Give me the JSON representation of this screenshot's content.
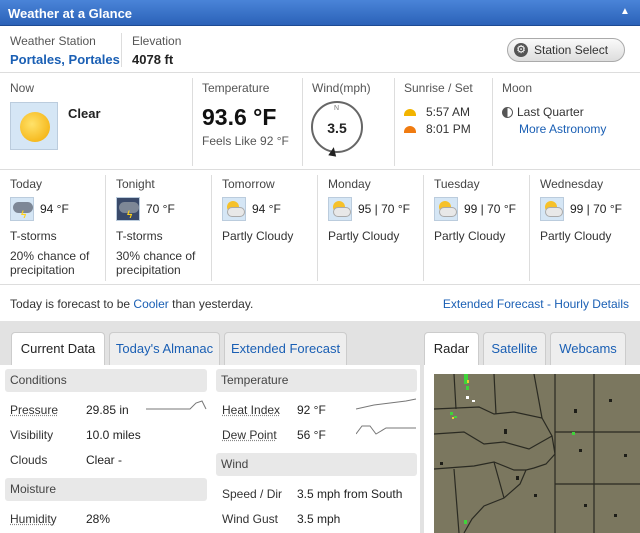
{
  "title": "Weather at a Glance",
  "station": {
    "label": "Weather Station",
    "name": "Portales, Portales"
  },
  "elevation": {
    "label": "Elevation",
    "value": "4078 ft"
  },
  "station_select": "Station Select",
  "now": {
    "label": "Now",
    "condition": "Clear",
    "icon": "sun-icon"
  },
  "temperature": {
    "label": "Temperature",
    "value": "93.6 °F",
    "feels_like": "Feels Like 92 °F"
  },
  "wind": {
    "label": "Wind(mph)",
    "speed": "3.5",
    "compass_n": "N"
  },
  "sun": {
    "label": "Sunrise / Set",
    "sunrise": "5:57 AM",
    "sunset": "8:01 PM"
  },
  "moon": {
    "label": "Moon",
    "phase": "Last Quarter",
    "link": "More Astronomy"
  },
  "forecast": [
    {
      "day": "Today",
      "temps": "94 °F",
      "cond": "T-storms",
      "precip": "20% chance of precipitation",
      "icon": "tstorm-icon"
    },
    {
      "day": "Tonight",
      "temps": "70 °F",
      "cond": "T-storms",
      "precip": "30% chance of precipitation",
      "icon": "tstorm-night-icon"
    },
    {
      "day": "Tomorrow",
      "temps": "94 °F",
      "cond": "Partly Cloudy",
      "precip": "",
      "icon": "partly-cloudy-icon"
    },
    {
      "day": "Monday",
      "temps": "95 | 70 °F",
      "cond": "Partly Cloudy",
      "precip": "",
      "icon": "partly-cloudy-icon"
    },
    {
      "day": "Tuesday",
      "temps": "99 | 70 °F",
      "cond": "Partly Cloudy",
      "precip": "",
      "icon": "partly-cloudy-icon"
    },
    {
      "day": "Wednesday",
      "temps": "99 | 70 °F",
      "cond": "Partly Cloudy",
      "precip": "",
      "icon": "partly-cloudy-icon"
    }
  ],
  "summary": {
    "prefix": "Today is forecast to be",
    "word": "Cooler",
    "suffix": "than yesterday."
  },
  "links": {
    "extended": "Extended Forecast",
    "sep": "-",
    "hourly": "Hourly Details"
  },
  "tabs": [
    "Current Data",
    "Today's Almanac",
    "Extended Forecast"
  ],
  "map_tabs": [
    "Radar",
    "Satellite",
    "Webcams"
  ],
  "conditions": {
    "header": "Conditions",
    "rows": [
      {
        "label": "Pressure",
        "value": "29.85 in"
      },
      {
        "label": "Visibility",
        "value": "10.0 miles"
      },
      {
        "label": "Clouds",
        "value": "Clear -"
      }
    ]
  },
  "moisture": {
    "header": "Moisture",
    "rows": [
      {
        "label": "Humidity",
        "value": "28%"
      }
    ]
  },
  "temp_section": {
    "header": "Temperature",
    "rows": [
      {
        "label": "Heat Index",
        "value": "92 °F"
      },
      {
        "label": "Dew Point",
        "value": "56 °F"
      }
    ]
  },
  "wind_section": {
    "header": "Wind",
    "rows": [
      {
        "label": "Speed / Dir",
        "value": "3.5 mph from South"
      },
      {
        "label": "Wind Gust",
        "value": "3.5 mph"
      }
    ]
  },
  "colors": {
    "title_bar": "#2b62b8",
    "link": "#1a5fb4",
    "radar_land": "#7b775f"
  }
}
